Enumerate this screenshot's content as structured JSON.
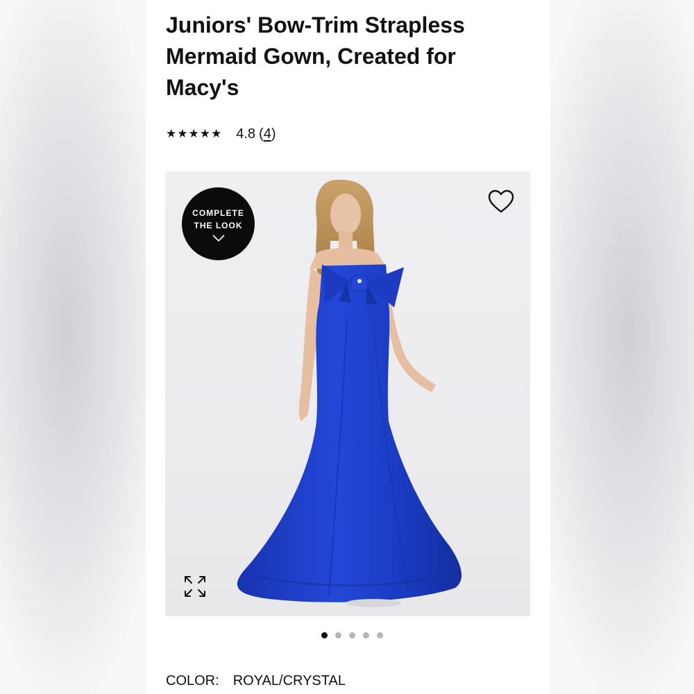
{
  "product": {
    "title": "Juniors' Bow-Trim Strapless Mermaid Gown, Created for Macy's",
    "rating": {
      "stars": "★★★★★",
      "value": "4.8",
      "count_open": "(",
      "count": "4",
      "count_close": ")"
    }
  },
  "gallery": {
    "complete_the_look": {
      "line1": "COMPLETE",
      "line2": "THE LOOK",
      "icon": "chevron-down-icon"
    },
    "favorite_icon": "heart-icon",
    "expand_icon": "expand-icon",
    "page_count": 5,
    "active_page": 1
  },
  "color": {
    "label": "COLOR:",
    "value": "ROYAL/CRYSTAL"
  },
  "colors": {
    "gown": "#1f3fc8",
    "badge": "#0b0b0b",
    "background": "#ececef"
  }
}
